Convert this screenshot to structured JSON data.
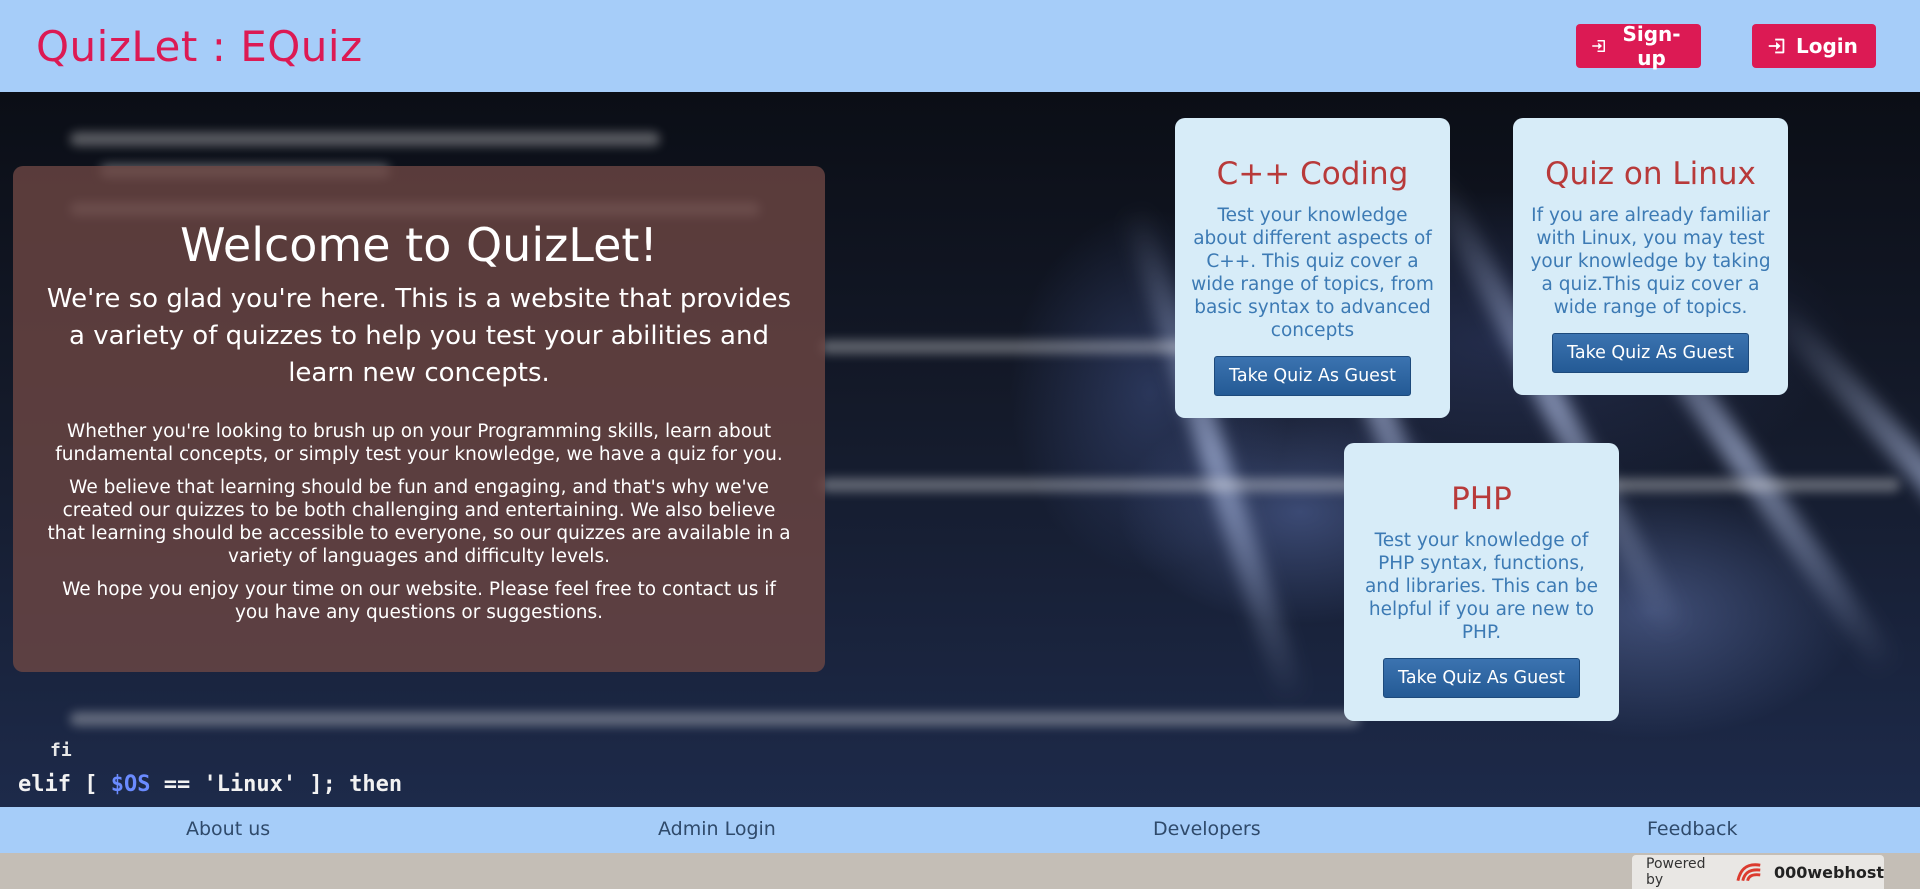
{
  "header": {
    "brand": "QuizLet : EQuiz",
    "signup_label": "Sign-up",
    "login_label": "Login",
    "brand_color": "#dc1a54",
    "background_color": "#a6cdf9"
  },
  "hero": {
    "code_line_prefix": "elif [ ",
    "code_line_var": "$OS",
    "code_line_suffix": " == 'Linux' ]; then",
    "code_corner": "fi"
  },
  "welcome": {
    "title": "Welcome to QuizLet!",
    "lead": "We're so glad you're here. This is a website that provides a variety of quizzes to help you test your abilities and learn new concepts.",
    "paragraphs": [
      "Whether you're looking to brush up on your Programming skills, learn about fundamental concepts, or simply test your knowledge, we have a quiz for you.",
      "We believe that learning should be fun and engaging, and that's why we've created our quizzes to be both challenging and entertaining. We also believe that learning should be accessible to everyone, so our quizzes are available in a variety of languages and difficulty levels.",
      "We hope you enjoy your time on our website. Please feel free to contact us if you have any questions or suggestions."
    ]
  },
  "quizzes": [
    {
      "title": "C++ Coding",
      "description": "Test your knowledge about different aspects of C++. This quiz cover a wide range of topics, from basic syntax to advanced concepts",
      "button_label": "Take Quiz As Guest"
    },
    {
      "title": "Quiz on Linux",
      "description": "If you are already familiar with Linux, you may test your knowledge by taking a quiz.This quiz cover a wide range of topics.",
      "button_label": "Take Quiz As Guest"
    },
    {
      "title": "PHP",
      "description": "Test your knowledge of PHP syntax, functions, and libraries. This can be helpful if you are new to PHP.",
      "button_label": "Take Quiz As Guest"
    }
  ],
  "footer": {
    "links": [
      "About us",
      "Admin Login",
      "Developers",
      "Feedback"
    ]
  },
  "powered_by": {
    "label": "Powered by",
    "name": "000webhost"
  }
}
